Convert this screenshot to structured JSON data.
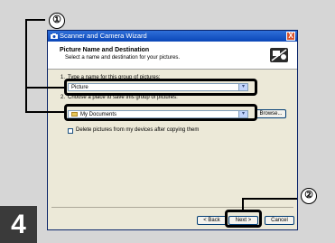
{
  "window": {
    "title": "Scanner and Camera Wizard",
    "close_label": "X"
  },
  "header": {
    "title": "Picture Name and Destination",
    "subtitle": "Select a name and destination for your pictures."
  },
  "form": {
    "name_prompt_num": "1.",
    "name_prompt": "Type a name for this group of pictures:",
    "name_value": "Picture",
    "place_prompt_num": "2.",
    "place_prompt": "Choose a place to save this group of pictures:",
    "place_value": "My Documents",
    "browse_label": "Browse...",
    "delete_label": "Delete pictures from my devices after copying them"
  },
  "buttons": {
    "back": "< Back",
    "next": "Next >",
    "cancel": "Cancel"
  },
  "callouts": {
    "one": "①",
    "two": "②"
  },
  "step_number": "4",
  "colors": {
    "title_bar": "#0a46b8",
    "dialog_bg": "#ece9d8",
    "step_bg": "#3a3a3a"
  },
  "icons": {
    "wizard": "scanner-camera-icon",
    "folder": "folder-icon"
  }
}
